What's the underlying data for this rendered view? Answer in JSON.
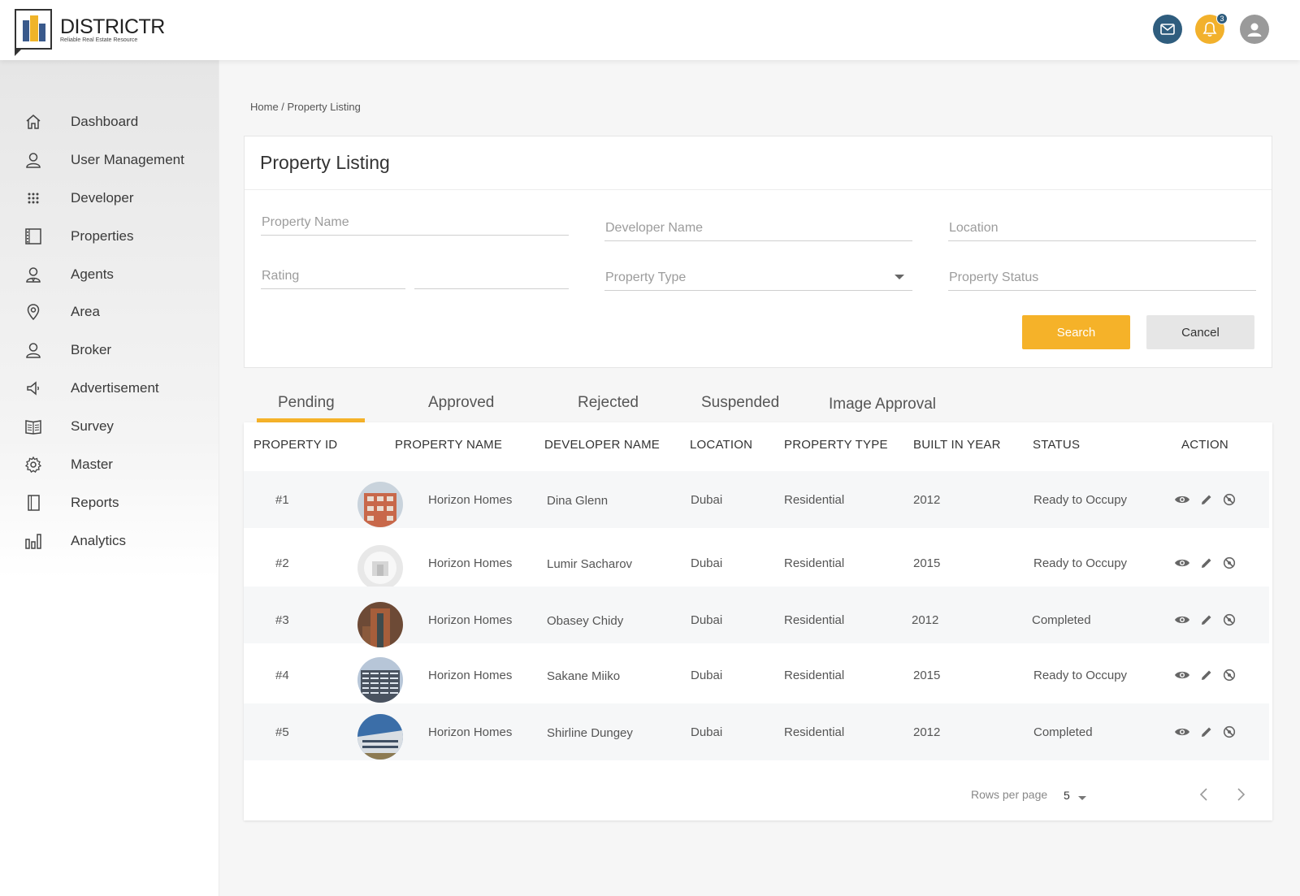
{
  "brand": {
    "name": "DISTRICTR",
    "tagline": "Reliable Real Estate Resource"
  },
  "header": {
    "notification_count": "3"
  },
  "sidebar": {
    "items": [
      {
        "label": "Dashboard",
        "icon": "home-icon"
      },
      {
        "label": "User Management",
        "icon": "user-icon"
      },
      {
        "label": "Developer",
        "icon": "grid-dots-icon"
      },
      {
        "label": "Properties",
        "icon": "building-icon"
      },
      {
        "label": "Agents",
        "icon": "agents-icon"
      },
      {
        "label": "Area",
        "icon": "location-pin-icon"
      },
      {
        "label": "Broker",
        "icon": "broker-icon"
      },
      {
        "label": "Advertisement",
        "icon": "megaphone-icon"
      },
      {
        "label": "Survey",
        "icon": "survey-book-icon"
      },
      {
        "label": "Master",
        "icon": "gear-icon"
      },
      {
        "label": "Reports",
        "icon": "notebook-icon"
      },
      {
        "label": "Analytics",
        "icon": "bar-chart-icon"
      }
    ]
  },
  "breadcrumb": "Home / Property Listing",
  "filter": {
    "title": "Property Listing",
    "property_name_ph": "Property Name",
    "developer_name_ph": "Developer Name",
    "location_ph": "Location",
    "rating_ph": "Rating",
    "property_type_ph": "Property Type",
    "property_status_ph": "Property Status",
    "search_label": "Search",
    "cancel_label": "Cancel"
  },
  "tabs": [
    "Pending",
    "Approved",
    "Rejected",
    "Suspended",
    "Image Approval"
  ],
  "table": {
    "headers": [
      "PROPERTY ID",
      "PROPERTY NAME",
      "DEVELOPER NAME",
      "LOCATION",
      "PROPERTY TYPE",
      "BUILT IN YEAR",
      "STATUS",
      "ACTION"
    ],
    "rows": [
      {
        "id": "#1",
        "name": "Horizon Homes",
        "developer": "Dina Glenn",
        "location": "Dubai",
        "type": "Residential",
        "year": "2012",
        "status": "Ready to Occupy"
      },
      {
        "id": "#2",
        "name": "Horizon Homes",
        "developer": "Lumir Sacharov",
        "location": "Dubai",
        "type": "Residential",
        "year": "2015",
        "status": "Ready to Occupy"
      },
      {
        "id": "#3",
        "name": "Horizon Homes",
        "developer": "Obasey Chidy",
        "location": "Dubai",
        "type": "Residential",
        "year": "2012",
        "status": "Completed"
      },
      {
        "id": "#4",
        "name": "Horizon Homes",
        "developer": "Sakane Miiko",
        "location": "Dubai",
        "type": "Residential",
        "year": "2015",
        "status": "Ready to Occupy"
      },
      {
        "id": "#5",
        "name": "Horizon Homes",
        "developer": "Shirline Dungey",
        "location": "Dubai",
        "type": "Residential",
        "year": "2012",
        "status": "Completed"
      }
    ]
  },
  "pagination": {
    "rows_per_page_label": "Rows per page",
    "rows_per_page_value": "5"
  },
  "colors": {
    "accent": "#f5b229",
    "mail": "#2f5d7e",
    "bell": "#f2b12c"
  }
}
